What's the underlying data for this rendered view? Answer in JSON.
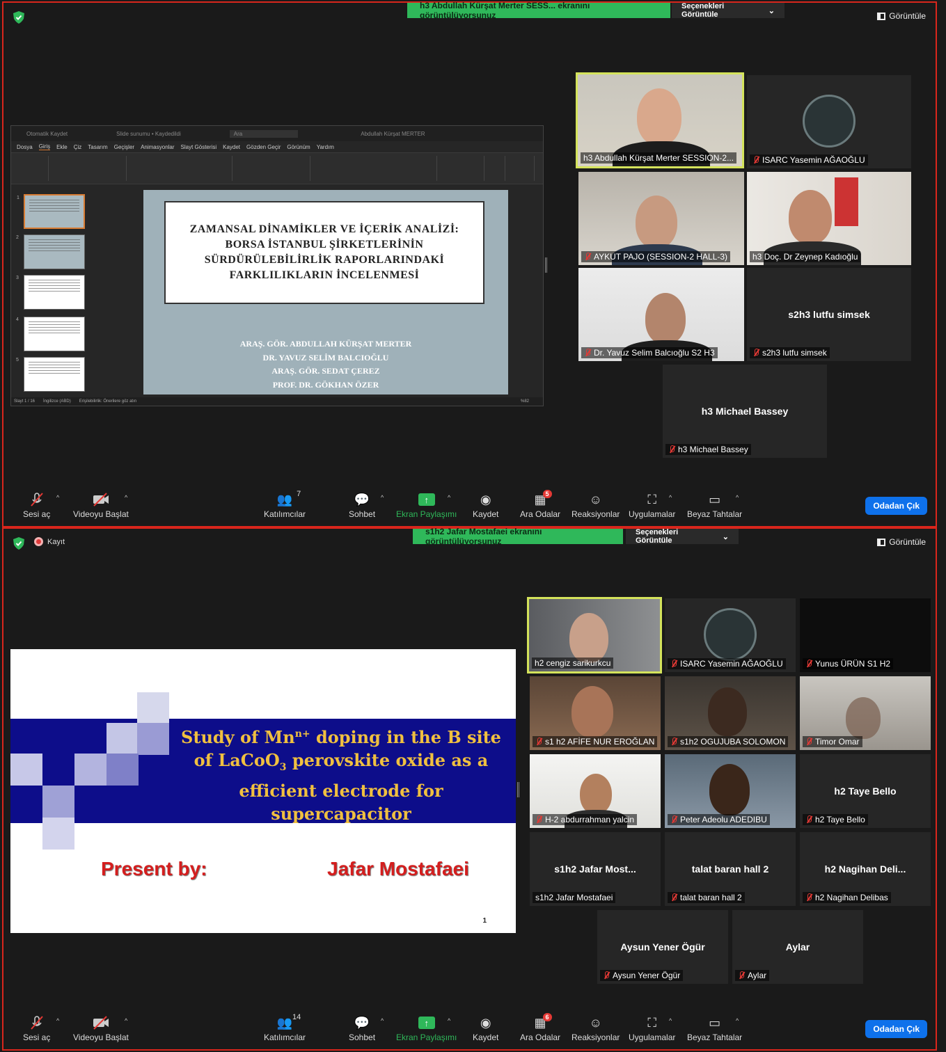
{
  "common_toolbar": {
    "mute_label": "Sesi aç",
    "video_label": "Videoyu Başlat",
    "participants_label": "Katılımcılar",
    "chat_label": "Sohbet",
    "share_label": "Ekran Paylaşımı",
    "record_label": "Kaydet",
    "rooms_label": "Ara Odalar",
    "reactions_label": "Reaksiyonlar",
    "apps_label": "Uygulamalar",
    "whiteboards_label": "Beyaz Tahtalar",
    "leave_label": "Odadan Çık",
    "view_label": "Görüntüle",
    "view_options_label": "Seçenekleri Görüntüle"
  },
  "window1": {
    "banner": "h3 Abdullah Kürşat Merter SESS... ekranını görüntülüyorsunuz",
    "participants_count": "7",
    "rooms_badge": "5",
    "ppt": {
      "title_left": "Otomatik Kaydet",
      "title_file": "Slide sunumu • Kaydedildi",
      "title_search": "Ara",
      "title_user": "Abdullah Kürşat MERTER",
      "menu": [
        "Dosya",
        "Giriş",
        "Ekle",
        "Çiz",
        "Tasarım",
        "Geçişler",
        "Animasyonlar",
        "Slayt Gösterisi",
        "Kaydet",
        "Gözden Geçir",
        "Görünüm",
        "Yardım"
      ],
      "status_left": "Slayt 1 / 16",
      "status_lang": "İngilizce (ABD)",
      "status_access": "Erişilebilirlik: Önerilere göz atın",
      "status_zoom": "%82",
      "slide_title": "ZAMANSAL DİNAMİKLER VE İÇERİK ANALİZİ: BORSA İSTANBUL ŞİRKETLERİNİN SÜRDÜRÜLEBİLİRLİK RAPORLARINDAKİ FARKLILIKLARIN İNCELENMESİ",
      "authors": [
        "ARAŞ. GÖR. ABDULLAH KÜRŞAT MERTER",
        "DR. YAVUZ SELİM BALCIOĞLU",
        "ARAŞ. GÖR. SEDAT ÇEREZ",
        "PROF. DR. GÖKHAN ÖZER"
      ]
    },
    "tiles": [
      {
        "name": "h3 Abdullah Kürşat Merter SESSION-2...",
        "muted": false
      },
      {
        "name": "ISARC Yasemin AĞAOĞLU",
        "muted": true
      },
      {
        "name": "AYKUT PAJO (SESSION-2 HALL-3)",
        "muted": true
      },
      {
        "name": "h3 Doç. Dr Zeynep Kadıoğlu",
        "muted": false
      },
      {
        "name": "Dr. Yavuz Selim Balcıoğlu S2 H3",
        "muted": true
      },
      {
        "name": "s2h3 lutfu simsek",
        "center": "s2h3 lutfu simsek",
        "muted": true
      },
      {
        "name": "h3 Michael Bassey",
        "center": "h3 Michael Bassey",
        "muted": true
      }
    ]
  },
  "window2": {
    "record_label": "Kayıt",
    "banner": "s1h2 Jafar Mostafaei ekranını görüntülüyorsunuz",
    "participants_count": "14",
    "rooms_badge": "6",
    "slide": {
      "title_parts": [
        "Study of Mn",
        "n+",
        " doping in the B site of LaCoO",
        "3",
        " perovskite oxide as a efficient electrode for supercapacitor"
      ],
      "present_label": "Present by:",
      "presenter": "Jafar Mostafaei",
      "page_number": "1"
    },
    "tiles": [
      {
        "name": "h2 cengiz sarikurkcu",
        "muted": false
      },
      {
        "name": "ISARC Yasemin AĞAOĞLU",
        "muted": true
      },
      {
        "name": "Yunus ÜRÜN S1 H2",
        "muted": true
      },
      {
        "name": "s1 h2 AFİFE NUR EROĞLAN",
        "muted": true
      },
      {
        "name": "s1h2 OGUJUBA SOLOMON",
        "muted": true
      },
      {
        "name": "Timor Omar",
        "muted": true
      },
      {
        "name": "H-2 abdurrahman yalcin",
        "muted": true
      },
      {
        "name": "Peter Adeolu ADEDIBU",
        "muted": true
      },
      {
        "name": "h2 Taye Bello",
        "center": "h2 Taye Bello",
        "muted": true
      },
      {
        "name": "s1h2 Jafar Mostafaei",
        "center": "s1h2 Jafar Most...",
        "muted": false
      },
      {
        "name": "talat baran hall 2",
        "center": "talat baran hall 2",
        "muted": true
      },
      {
        "name": "h2 Nagihan Delibas",
        "center": "h2  Nagihan Deli...",
        "muted": true
      },
      {
        "name": "Aysun Yener Ögür",
        "center": "Aysun Yener Ögür",
        "muted": true
      },
      {
        "name": "Aylar",
        "center": "Aylar",
        "muted": true
      }
    ]
  }
}
